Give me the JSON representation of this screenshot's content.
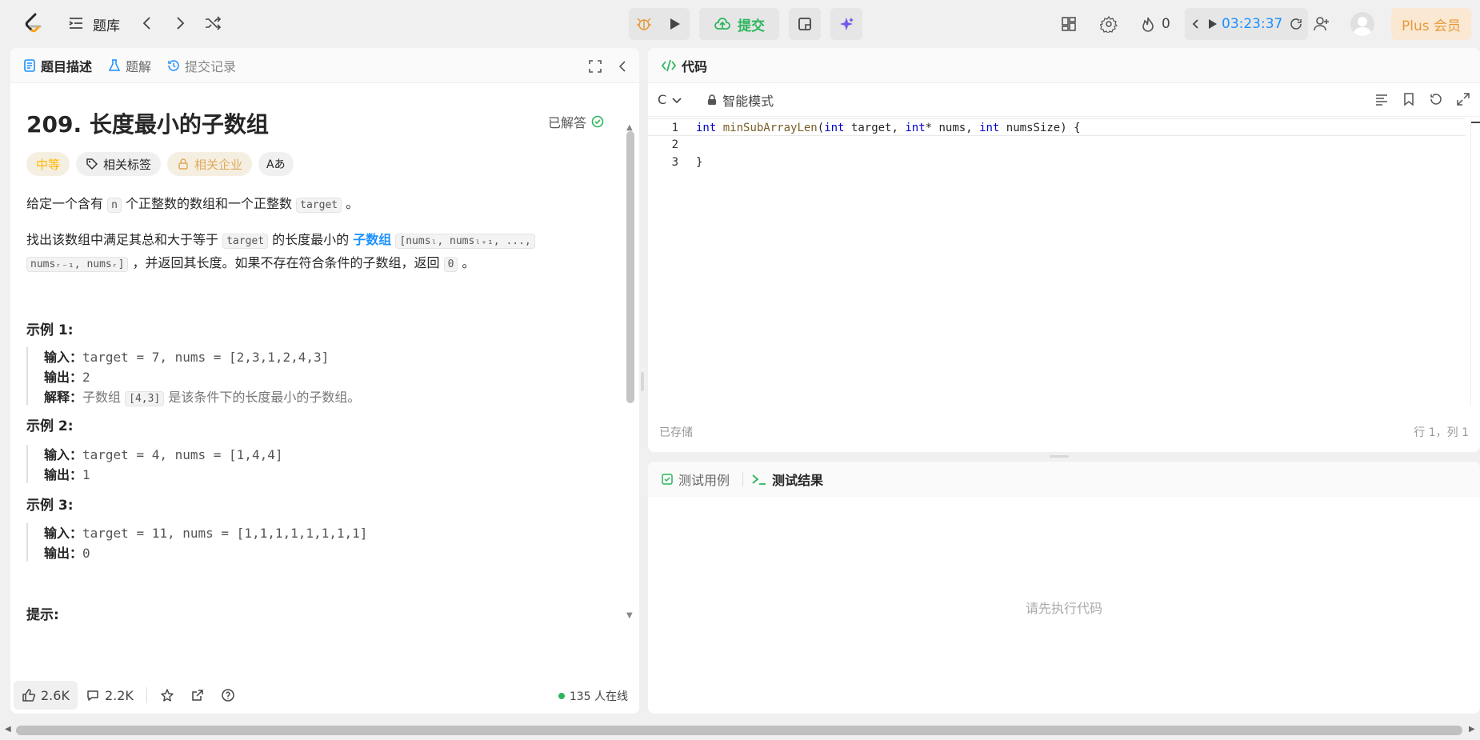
{
  "header": {
    "problem_bank_label": "题库",
    "submit_label": "提交",
    "streak_count": "0",
    "timer": "03:23:37",
    "plus_label": "Plus 会员"
  },
  "left_tabs": {
    "description": "题目描述",
    "solutions": "题解",
    "submissions": "提交记录"
  },
  "problem": {
    "title": "209. 长度最小的子数组",
    "status": "已解答",
    "tags": {
      "difficulty": "中等",
      "related_tags": "相关标签",
      "companies": "相关企业",
      "translate": "Aあ"
    },
    "p1_a": "给定一个含有",
    "p1_n": "n",
    "p1_b": "个正整数的数组和一个正整数",
    "p1_target": "target",
    "p1_c": "。",
    "p2_a": "找出该数组中满足其总和大于等于",
    "p2_target": "target",
    "p2_b": "的长度最小的",
    "p2_link": "子数组",
    "p2_code1": "[numsₗ, numsₗ₊₁, ...,",
    "p2_code2": "numsᵣ₋₁, numsᵣ]",
    "p2_c": "，并返回其长度。如果不存在符合条件的子数组，返回",
    "p2_zero": "0",
    "p2_d": "。"
  },
  "examples": [
    {
      "title": "示例 1:",
      "input_label": "输入：",
      "input": "target = 7, nums = [2,3,1,2,4,3]",
      "output_label": "输出：",
      "output": "2",
      "explain_label": "解释：",
      "explain_a": "子数组",
      "explain_code": "[4,3]",
      "explain_b": "是该条件下的长度最小的子数组。"
    },
    {
      "title": "示例 2:",
      "input_label": "输入：",
      "input": "target = 4, nums = [1,4,4]",
      "output_label": "输出：",
      "output": "1"
    },
    {
      "title": "示例 3:",
      "input_label": "输入：",
      "input": "target = 11, nums = [1,1,1,1,1,1,1,1]",
      "output_label": "输出：",
      "output": "0"
    }
  ],
  "hint_title": "提示:",
  "footer": {
    "likes": "2.6K",
    "comments": "2.2K",
    "online": "135 人在线"
  },
  "editor": {
    "tab_label": "代码",
    "language": "C",
    "mode": "智能模式",
    "lines": [
      {
        "num": "1",
        "kw1": "int",
        "fn": "minSubArrayLen",
        "p1": "(",
        "kw2": "int",
        "a1": " target, ",
        "kw3": "int",
        "a2": "* nums, ",
        "kw4": "int",
        "a3": " numsSize) {"
      },
      {
        "num": "2",
        "text": ""
      },
      {
        "num": "3",
        "text": "}"
      }
    ],
    "saved": "已存储",
    "position": "行 1，列 1"
  },
  "test": {
    "cases_tab": "测试用例",
    "results_tab": "测试结果",
    "empty": "请先执行代码"
  },
  "colors": {
    "accent_green": "#2db55d",
    "accent_blue": "#1a90ff",
    "difficulty_medium": "#ffb800"
  }
}
